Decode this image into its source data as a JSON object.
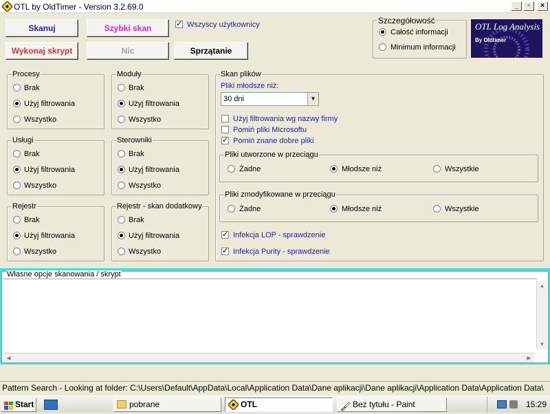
{
  "window": {
    "title": "OTL by OldTimer - Version 3.2.69.0"
  },
  "toolbar": {
    "scan": "Skanuj",
    "quick_scan": "Szybki skan",
    "run_script": "Wykonaj skrypt",
    "none": "Nic",
    "cleanup": "Sprzątanie",
    "all_users_label": "Wszyscy użytkownicy",
    "all_users_checked": true
  },
  "detail": {
    "title": "Szczegółowość",
    "full": "Całość informacji",
    "minimum": "Minimum informacji",
    "selected": "full"
  },
  "logo": {
    "line1": "OTL Log Analysis",
    "line2": "By Oldtimer"
  },
  "groups": [
    {
      "title": "Procesy",
      "options": [
        "Brak",
        "Użyj filtrowania",
        "Wszystko"
      ],
      "selected": 1
    },
    {
      "title": "Moduły",
      "options": [
        "Brak",
        "Użyj filtrowania",
        "Wszystko"
      ],
      "selected": 1
    },
    {
      "title": "Usługi",
      "options": [
        "Brak",
        "Użyj filtrowania",
        "Wszystko"
      ],
      "selected": 1
    },
    {
      "title": "Sterowniki",
      "options": [
        "Brak",
        "Użyj filtrowania",
        "Wszystko"
      ],
      "selected": 1
    },
    {
      "title": "Rejestr",
      "options": [
        "Brak",
        "Użyj filtrowania",
        "Wszystko"
      ],
      "selected": 1
    },
    {
      "title": "Rejestr - skan dodatkowy",
      "options": [
        "Brak",
        "Użyj filtrowania",
        "Wszystko"
      ],
      "selected": 1
    }
  ],
  "file_scan": {
    "title": "Skan plików",
    "younger_label": "Pliki młodsze niż:",
    "younger_value": "30 dni",
    "filter_company": "Użyj filtrowania wg nazwy firmy",
    "filter_company_checked": false,
    "skip_ms": "Pomiń pliki Microsoftu",
    "skip_ms_checked": false,
    "skip_good": "Pomiń znane dobre pliki",
    "skip_good_checked": true,
    "created": {
      "title": "Pliki utworzone w przeciągu",
      "options": [
        "Żadne",
        "Młodsze niż",
        "Wszystkie"
      ],
      "selected": 1
    },
    "modified": {
      "title": "Pliki zmodyfikowane w przeciągu",
      "options": [
        "Żadne",
        "Młodsze niż",
        "Wszystkie"
      ],
      "selected": 1
    },
    "lop": "Infekcja LOP - sprawdzenie",
    "lop_checked": true,
    "purity": "Infekcja Purity - sprawdzenie",
    "purity_checked": true
  },
  "custom": {
    "title": "Własne opcje skanowania / skrypt",
    "value": ""
  },
  "status": "Pattern Search - Looking at folder: C:\\Users\\Default\\AppData\\Local\\Application Data\\Dane aplikacji\\Dane aplikacji\\Application Data\\Application Data\\",
  "taskbar": {
    "start": "Start",
    "items": [
      "pobrane",
      "OTL",
      "Bez tytułu - Paint"
    ],
    "clock": "15:29"
  },
  "colors": {
    "accent_blue": "#2020b0",
    "run_red": "#e03030",
    "quick_magenta": "#e020e0",
    "memo_frame": "#40e0e0"
  }
}
